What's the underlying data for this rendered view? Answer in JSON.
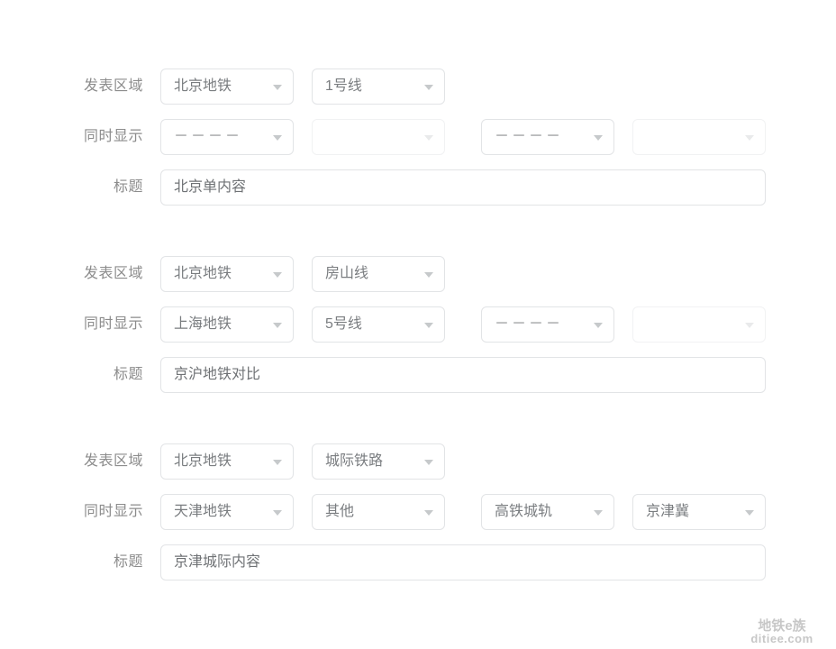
{
  "labels": {
    "area": "发表区域",
    "simultaneous": "同时显示",
    "title": "标题"
  },
  "groups": [
    {
      "area_row": {
        "label": "发表区域",
        "fields": [
          {
            "value": "北京地铁",
            "muted": false,
            "dashes": false
          },
          {
            "value": "1号线",
            "muted": false,
            "dashes": false
          }
        ]
      },
      "simul_row": {
        "label": "同时显示",
        "fields": [
          {
            "value": "－－－－",
            "muted": false,
            "dashes": true
          },
          {
            "value": "",
            "muted": true,
            "dashes": false
          },
          {
            "value": "－－－－",
            "muted": false,
            "dashes": true
          },
          {
            "value": "",
            "muted": true,
            "dashes": false
          }
        ]
      },
      "title_row": {
        "label": "标题",
        "value": "北京单内容"
      }
    },
    {
      "area_row": {
        "label": "发表区域",
        "fields": [
          {
            "value": "北京地铁",
            "muted": false,
            "dashes": false
          },
          {
            "value": "房山线",
            "muted": false,
            "dashes": false
          }
        ]
      },
      "simul_row": {
        "label": "同时显示",
        "fields": [
          {
            "value": "上海地铁",
            "muted": false,
            "dashes": false
          },
          {
            "value": "5号线",
            "muted": false,
            "dashes": false
          },
          {
            "value": "－－－－",
            "muted": false,
            "dashes": true
          },
          {
            "value": "",
            "muted": true,
            "dashes": false
          }
        ]
      },
      "title_row": {
        "label": "标题",
        "value": "京沪地铁对比"
      }
    },
    {
      "area_row": {
        "label": "发表区域",
        "fields": [
          {
            "value": "北京地铁",
            "muted": false,
            "dashes": false
          },
          {
            "value": "城际铁路",
            "muted": false,
            "dashes": false
          }
        ]
      },
      "simul_row": {
        "label": "同时显示",
        "fields": [
          {
            "value": "天津地铁",
            "muted": false,
            "dashes": false
          },
          {
            "value": "其他",
            "muted": false,
            "dashes": false
          },
          {
            "value": "高铁城轨",
            "muted": false,
            "dashes": false
          },
          {
            "value": "京津冀",
            "muted": false,
            "dashes": false
          }
        ]
      },
      "title_row": {
        "label": "标题",
        "value": "京津城际内容"
      }
    }
  ],
  "watermark": {
    "top": "地铁e族",
    "bottom": "ditiee.com"
  },
  "colors": {
    "border": "#e2e4e6",
    "border_muted": "#f1f2f3",
    "text": "#7a7d80",
    "label": "#8c8c8c",
    "arrow": "#c6c9cb",
    "background": "#ffffff"
  }
}
